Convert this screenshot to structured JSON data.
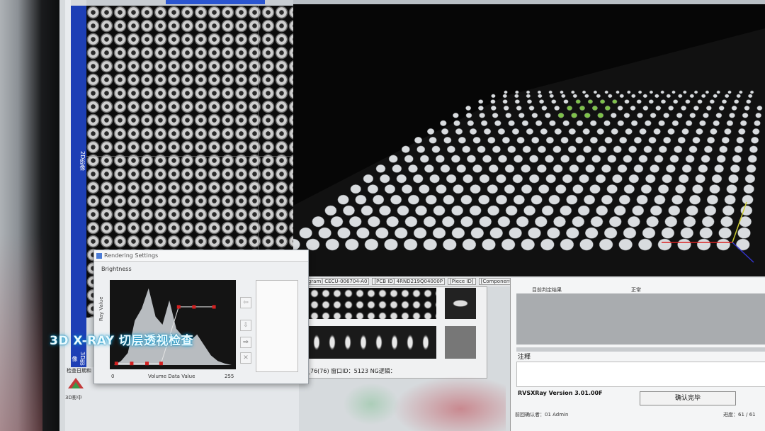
{
  "caption": "3D X-RAY 切层透视检查",
  "left_tabs": {
    "tab_2d": "2D影像",
    "tab_3d": "3D影像"
  },
  "info_bar": {
    "program": "[Program] CECU-006704-A0",
    "pcb_id": "[PCB ID] 4RND219Q04000P",
    "piece_id": "[Piece ID]",
    "component": "[Component] BGA_ 76"
  },
  "mid_status": "_76(76)  窗口ID：5123  NG逻辑：",
  "dialog": {
    "title": "Rendering Settings",
    "brightness_label": "Brightness",
    "y_axis_label": "Ray Value",
    "x_axis_label": "Volume Data Value",
    "x_min": "0",
    "x_max": "255",
    "buttons": {
      "arrow_left": "⇦",
      "arrow_down": "⇩",
      "arrow_right": "⇨",
      "close": "✕"
    }
  },
  "bottom_left": {
    "date_label": "检查日期和",
    "small_label": "3D影中"
  },
  "result_panel": {
    "header_left": "目前判定结果",
    "header_right": "正常",
    "note_label": "注释",
    "version": "RVSXRay Version 3.01.00F",
    "confirm_button": "确认完毕",
    "operator": "前回确认者：01  Admin",
    "progress": "进度：61 / 61"
  },
  "histogram": {
    "curve": [
      0,
      0.05,
      0.15,
      0.55,
      0.7,
      0.95,
      0.6,
      0.5,
      0.8,
      0.45,
      0.35,
      0.3,
      0.38,
      0.25,
      0.12,
      0.05,
      0.02,
      0
    ],
    "control_points": [
      [
        0.02,
        0.02
      ],
      [
        0.15,
        0.02
      ],
      [
        0.28,
        0.02
      ],
      [
        0.4,
        0.02
      ],
      [
        0.55,
        0.72
      ],
      [
        0.68,
        0.72
      ],
      [
        0.85,
        0.72
      ]
    ]
  },
  "colors": {
    "accent_blue": "#1d3fb5",
    "highlight_green": "#7fc24a",
    "control_point_red": "#d42020"
  }
}
